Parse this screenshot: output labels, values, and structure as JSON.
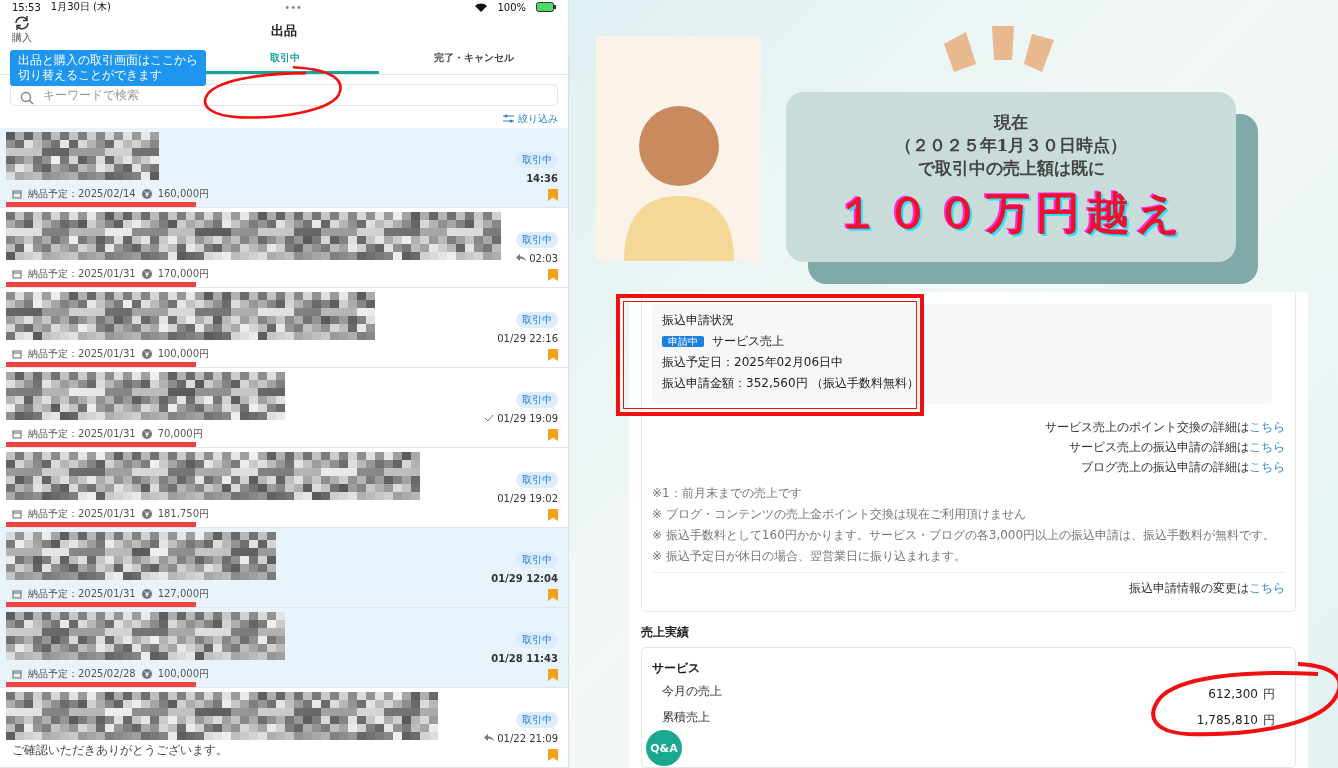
{
  "status_bar": {
    "time": "15:53",
    "date": "1月30日 (木)",
    "dots": "•••",
    "battery": "100%"
  },
  "header": {
    "switch_label": "購入",
    "title": "出品",
    "tooltip_lines": [
      "出品と購入の取引画面はここから",
      "切り替えることができます"
    ]
  },
  "tabs": [
    {
      "label": "取引中",
      "selected": true
    },
    {
      "label": "完了・キャンセル",
      "selected": false
    }
  ],
  "search": {
    "placeholder": "キーワードで検索"
  },
  "filter_label": "絞り込み",
  "orders": [
    {
      "highlighted": true,
      "status": "取引中",
      "replied": false,
      "read_check": false,
      "time": "14:36",
      "delivery": "納品予定：2025/02/14",
      "price": "160,000円"
    },
    {
      "highlighted": false,
      "status": "取引中",
      "replied": true,
      "read_check": false,
      "time": "02:03",
      "delivery": "納品予定：2025/01/31",
      "price": "170,000円"
    },
    {
      "highlighted": false,
      "status": "取引中",
      "replied": false,
      "read_check": false,
      "time": "01/29 22:16",
      "delivery": "納品予定：2025/01/31",
      "price": "100,000円"
    },
    {
      "highlighted": false,
      "status": "取引中",
      "replied": false,
      "read_check": true,
      "time": "01/29 19:09",
      "delivery": "納品予定：2025/01/31",
      "price": "70,000円"
    },
    {
      "highlighted": false,
      "status": "取引中",
      "replied": false,
      "read_check": false,
      "time": "01/29 19:02",
      "delivery": "納品予定：2025/01/31",
      "price": "181,750円"
    },
    {
      "highlighted": true,
      "status": "取引中",
      "replied": false,
      "read_check": false,
      "time": "01/29 12:04",
      "delivery": "納品予定：2025/01/31",
      "price": "127,000円"
    },
    {
      "highlighted": true,
      "status": "取引中",
      "replied": false,
      "read_check": false,
      "time": "01/28 11:43",
      "delivery": "納品予定：2025/02/28",
      "price": "100,000円"
    },
    {
      "highlighted": false,
      "status": "取引中",
      "replied": true,
      "read_check": false,
      "time": "01/22 21:09",
      "message": "ご確認いただきありがとうございます。"
    }
  ],
  "banner": {
    "lines": [
      "現在",
      "（２０２５年1月３０日時点）",
      "で取引中の売上額は既に"
    ],
    "headline": "１００万円越え"
  },
  "transfer_status": {
    "title": "振込申請状況",
    "badge": "申請中",
    "type": "サービス売上",
    "date": "振込予定日：2025年02月06日中",
    "amount": "振込申請金額：352,560円 （振込手数料無料）"
  },
  "detail_links": [
    {
      "text": "サービス売上のポイント交換の詳細は",
      "link": "こちら"
    },
    {
      "text": "サービス売上の振込申請の詳細は",
      "link": "こちら"
    },
    {
      "text": "ブログ売上の振込申請の詳細は",
      "link": "こちら"
    }
  ],
  "notes": [
    "※1：前月末までの売上です",
    "※ ブログ・コンテンツの売上金ポイント交換は現在ご利用頂けません",
    "※ 振込手数料として160円かかります。サービス・ブログの各3,000円以上の振込申請は、振込手数料が無料です。",
    "※ 振込予定日が休日の場合、翌営業日に振り込まれます。"
  ],
  "change_link": {
    "text": "振込申請情報の変更は",
    "link": "こちら"
  },
  "sales": {
    "heading": "売上実績",
    "section": "サービス",
    "rows": [
      {
        "label": "今月の売上",
        "value": "612,300",
        "unit": "円"
      },
      {
        "label": "累積売上",
        "value": "1,785,810",
        "unit": "円"
      }
    ]
  },
  "qa_button": "Q&A"
}
